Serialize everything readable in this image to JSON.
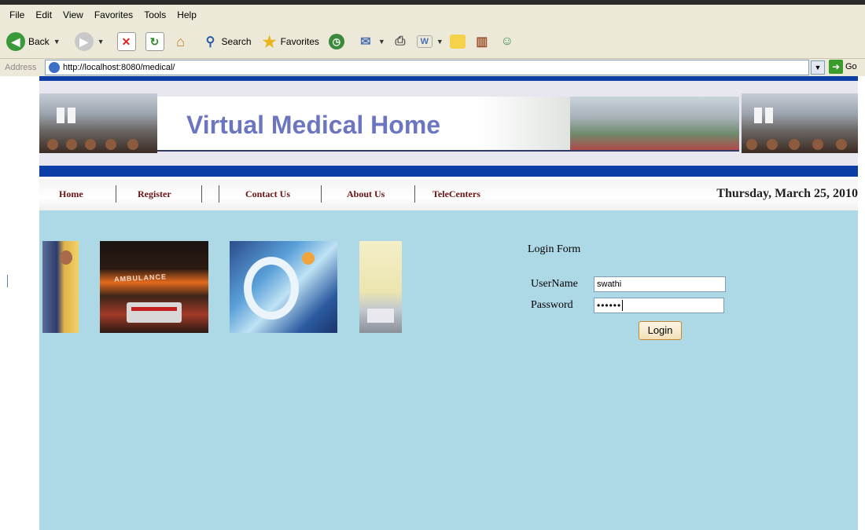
{
  "menu": [
    "File",
    "Edit",
    "View",
    "Favorites",
    "Tools",
    "Help"
  ],
  "toolbar": {
    "back_label": "Back",
    "search_label": "Search",
    "favorites_label": "Favorites"
  },
  "address": {
    "label": "Address",
    "url": "http://localhost:8080/medical/",
    "go_label": "Go"
  },
  "site": {
    "title": "Virtual Medical Home"
  },
  "nav": {
    "items": [
      "Home",
      "Register",
      "Contact Us",
      "About Us",
      "TeleCenters"
    ],
    "date": "Thursday, March 25, 2010"
  },
  "photos": {
    "ambulance_sign": "AMBULANCE"
  },
  "login": {
    "title": "Login Form",
    "username_label": "UserName",
    "username_value": "swathi",
    "password_label": "Password",
    "password_value": "••••••",
    "button_label": "Login"
  },
  "colors": {
    "nav_blue": "#0d3fa5",
    "content_bg": "#add8e6",
    "title_color": "#6c76c0",
    "nav_text": "#6b1212"
  }
}
